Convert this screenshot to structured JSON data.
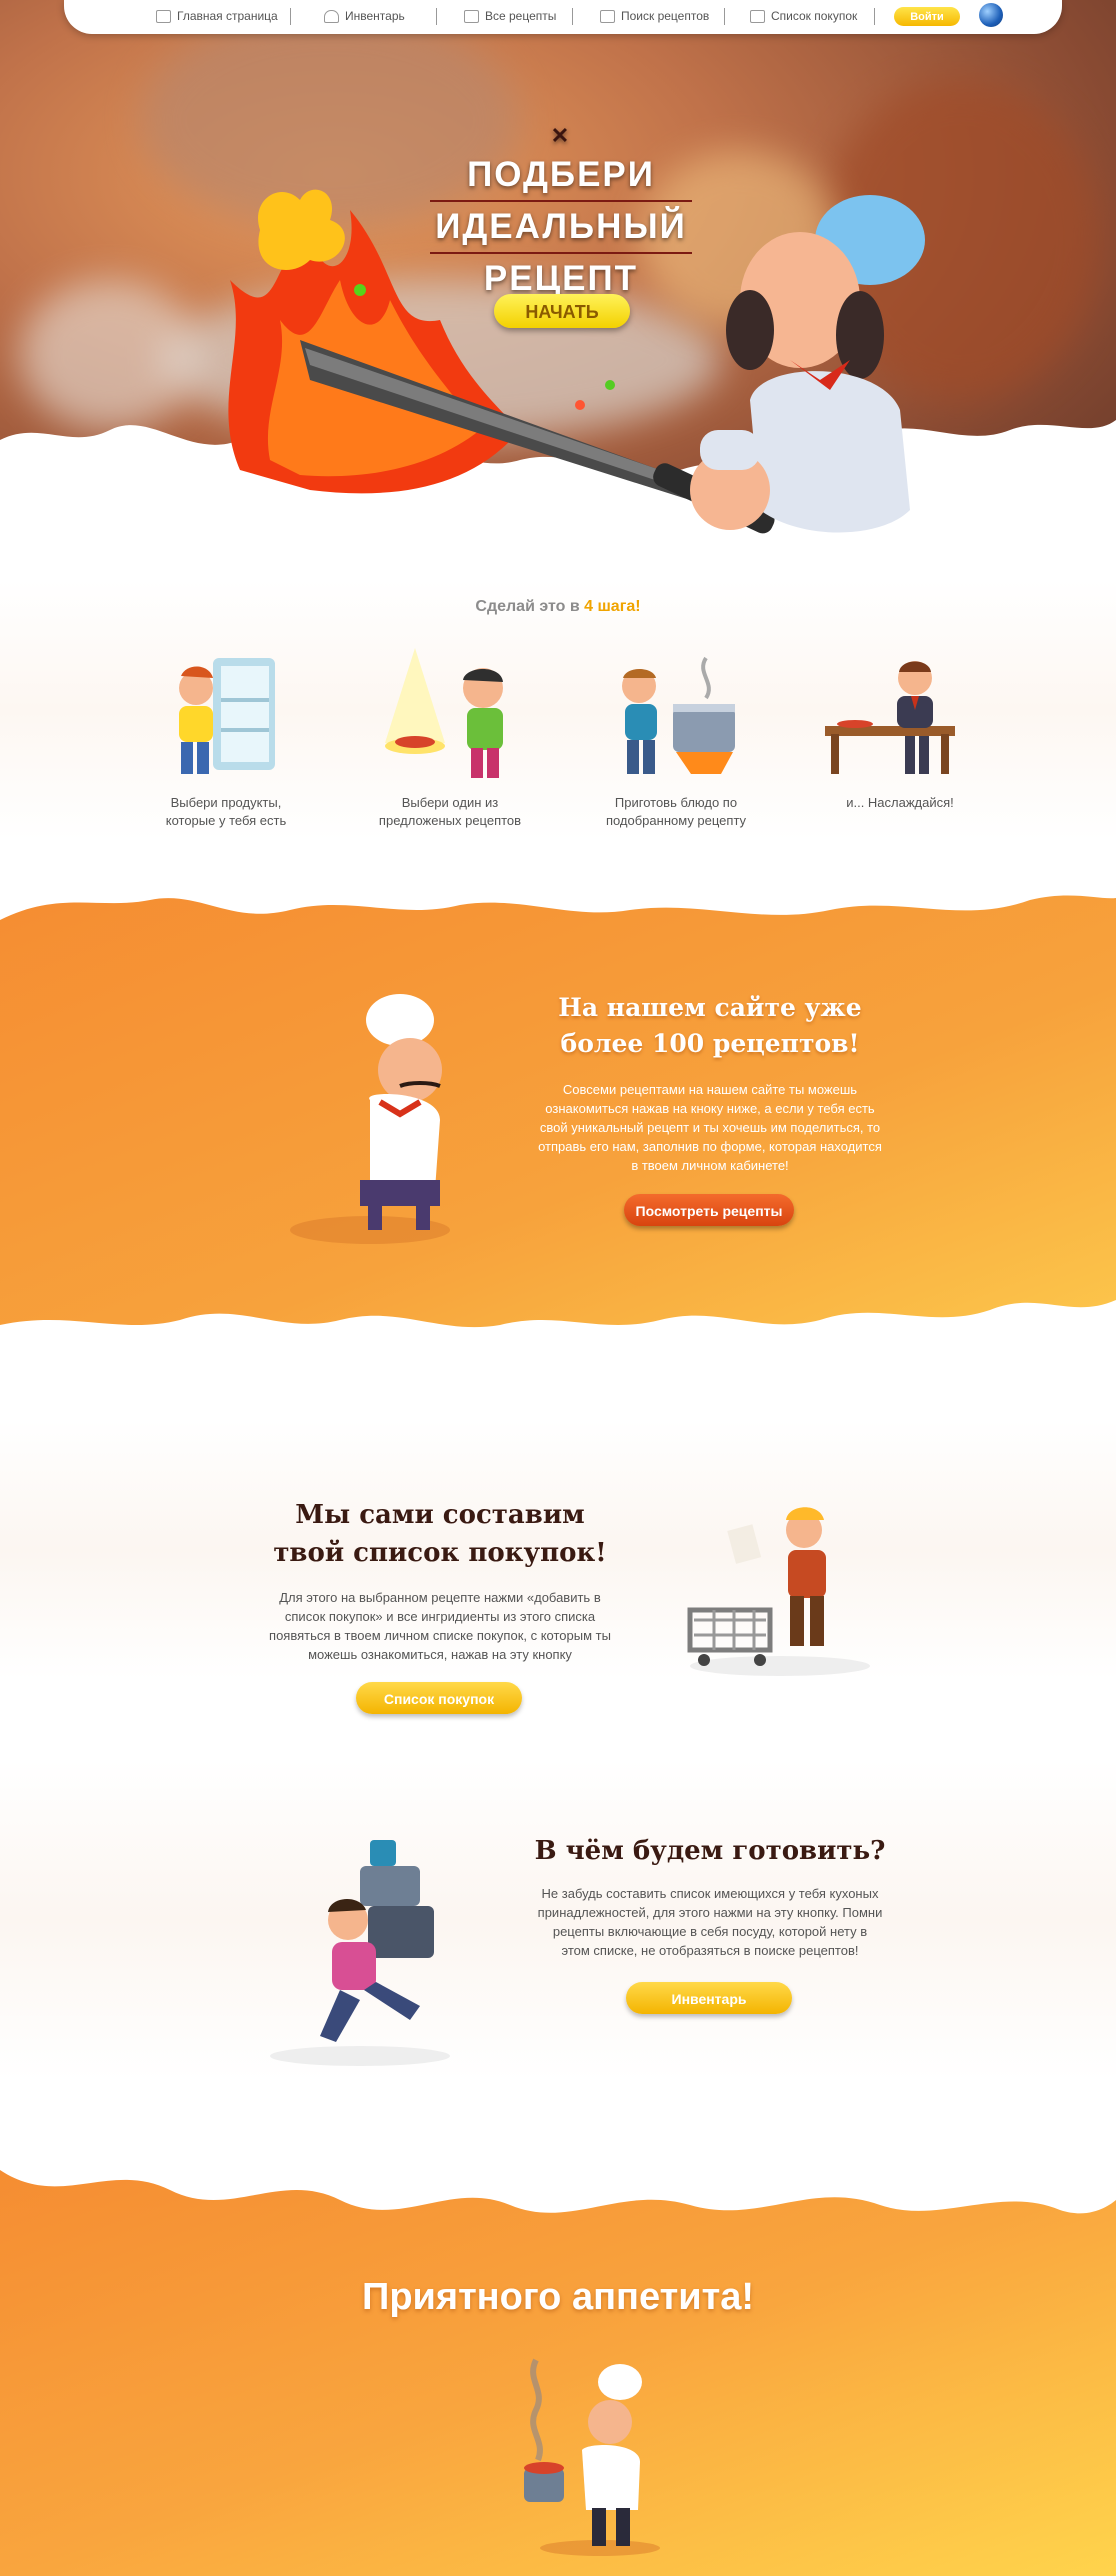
{
  "nav": {
    "items": [
      {
        "label": "Главная страница",
        "icon": "home-icon"
      },
      {
        "label": "Инвентарь",
        "icon": "pot-icon"
      },
      {
        "label": "Все рецепты",
        "icon": "cart-icon"
      },
      {
        "label": "Поиск рецептов",
        "icon": "search-book-icon"
      },
      {
        "label": "Список покупок",
        "icon": "list-icon"
      }
    ],
    "login_label": "Войти",
    "language_icon": "globe-icon"
  },
  "hero": {
    "title_lines": [
      "ПОДБЕРИ",
      "ИДЕАЛЬНЫЙ",
      "РЕЦЕПТ"
    ],
    "start_label": "НАЧАТЬ"
  },
  "steps": {
    "title_prefix": "Сделай это в",
    "title_highlight": "4 шага!",
    "items": [
      {
        "line1": "Выбери продукты,",
        "line2": "которые у тебя есть"
      },
      {
        "line1": "Выбери один из",
        "line2": "предложеных рецептов"
      },
      {
        "line1": "Приготовь блюдо по",
        "line2": "подобранному рецепту"
      },
      {
        "line1": "и... Наслаждайся!",
        "line2": ""
      }
    ]
  },
  "recipes_section": {
    "title_line1": "На нашем сайте уже",
    "title_line2": "более 100 рецептов!",
    "text_lines": [
      "Совсеми рецептами на нашем сайте ты можешь",
      "ознакомиться нажав на кноку ниже, а если у тебя есть",
      "свой уникальный рецепт и ты хочешь им поделиться, то",
      "отправь его нам, заполнив по форме, которая находится",
      "в твоем личном кабинете!"
    ],
    "button_label": "Посмотреть рецепты"
  },
  "shopping_section": {
    "title_line1": "Мы сами составим",
    "title_line2": "твой список покупок!",
    "text_lines": [
      "Для этого на выбранном рецепте нажми «добавить в",
      "список покупок» и все ингридиенты из этого списка",
      "появяться в твоем личном списке покупок, с которым ты",
      "можешь ознакомиться, нажав на эту кнопку"
    ],
    "button_label": "Список покупок"
  },
  "inventory_section": {
    "title": "В чём будем готовить?",
    "text_lines": [
      "Не забудь составить список имеющихся у тебя кухоных",
      "принадлежностей, для этого нажми на эту кнопку. Помни",
      "рецепты включающие в себя посуду, которой нету в",
      "этом списке, не отобразяться в поиске рецептов!"
    ],
    "button_label": "Инвентарь"
  },
  "footer": {
    "title": "Приятного аппетита!"
  },
  "colors": {
    "orange": "#f59a3a",
    "yellow": "#ffd34a",
    "button_red": "#e35416",
    "button_yellow": "#f6bd12",
    "highlight": "#f0a400"
  }
}
